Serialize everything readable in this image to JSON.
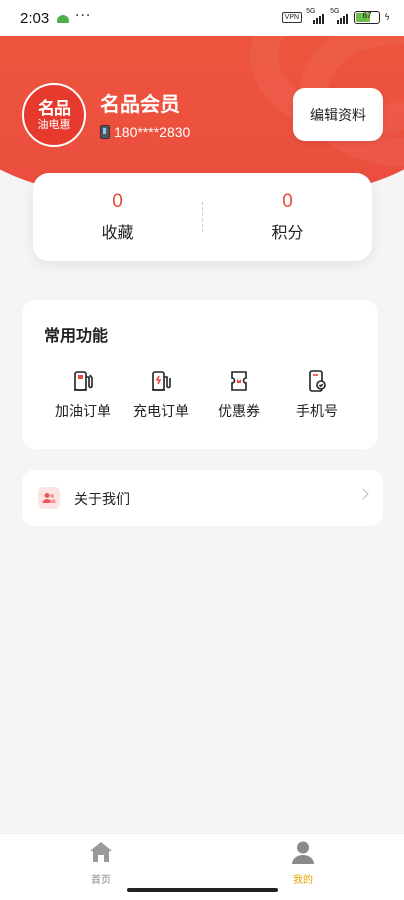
{
  "status_bar": {
    "time": "2:03",
    "dots": "···",
    "vpn": "VPN",
    "network1": "5G",
    "network2": "5G",
    "battery": "67",
    "battery_level": 0.67
  },
  "profile": {
    "avatar_line1": "名品",
    "avatar_line2": "油电惠",
    "name": "名品会员",
    "phone": "180****2830",
    "edit_label": "编辑资料"
  },
  "stats": [
    {
      "value": "0",
      "label": "收藏"
    },
    {
      "value": "0",
      "label": "积分"
    }
  ],
  "functions": {
    "title": "常用功能",
    "items": [
      {
        "label": "加油订单",
        "icon": "fuel-pump-icon"
      },
      {
        "label": "充电订单",
        "icon": "charging-pile-icon"
      },
      {
        "label": "优惠券",
        "icon": "coupon-icon"
      },
      {
        "label": "手机号",
        "icon": "phone-check-icon"
      }
    ]
  },
  "about": {
    "label": "关于我们",
    "icon": "users-icon"
  },
  "nav": {
    "items": [
      {
        "label": "首页",
        "icon": "home-icon",
        "active": false
      },
      {
        "label": "我的",
        "icon": "user-icon",
        "active": true
      }
    ]
  },
  "colors": {
    "brand": "#ea4d3f",
    "active_tab": "#e6a300",
    "inactive_tab": "#8a8a8a"
  }
}
